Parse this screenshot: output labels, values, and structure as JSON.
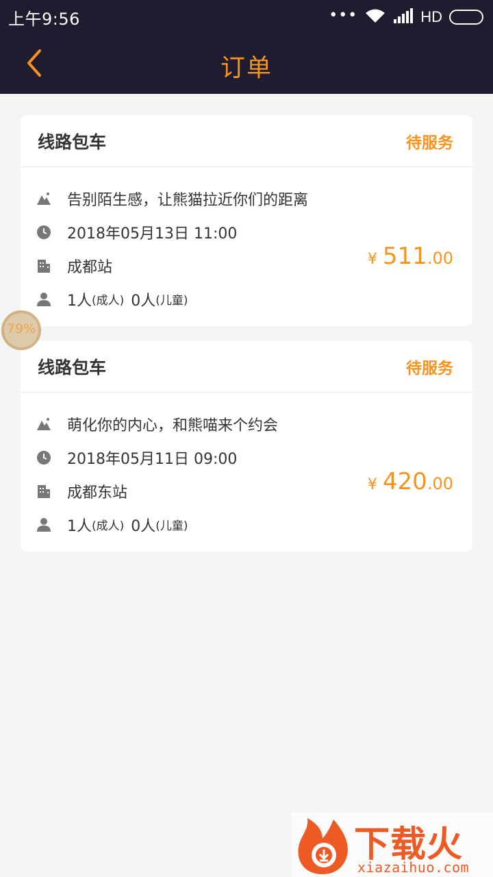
{
  "status_bar": {
    "time": "上午9:56",
    "dots": "•••",
    "network": "HD"
  },
  "header": {
    "title": "订单"
  },
  "orders": [
    {
      "type": "线路包车",
      "status": "待服务",
      "route": "告别陌生感，让熊猫拉近你们的距离",
      "datetime": "2018年05月13日 11:00",
      "station": "成都站",
      "adults": "1人",
      "adults_label": "(成人)",
      "children": "0人",
      "children_label": "(儿童)",
      "currency": "¥",
      "price_int": "511",
      "price_dec": ".00"
    },
    {
      "type": "线路包车",
      "status": "待服务",
      "route": "萌化你的内心，和熊喵来个约会",
      "datetime": "2018年05月11日 09:00",
      "station": "成都东站",
      "adults": "1人",
      "adults_label": "(成人)",
      "children": "0人",
      "children_label": "(儿童)",
      "currency": "¥",
      "price_int": "420",
      "price_dec": ".00"
    }
  ],
  "floating_badge": {
    "percent": "79%"
  },
  "watermark": {
    "cn": "下载火",
    "en": "xiazaihuo.com"
  },
  "colors": {
    "accent": "#f7931e",
    "header_bg": "#1e1c2e",
    "page_bg": "#f4f4f4"
  }
}
